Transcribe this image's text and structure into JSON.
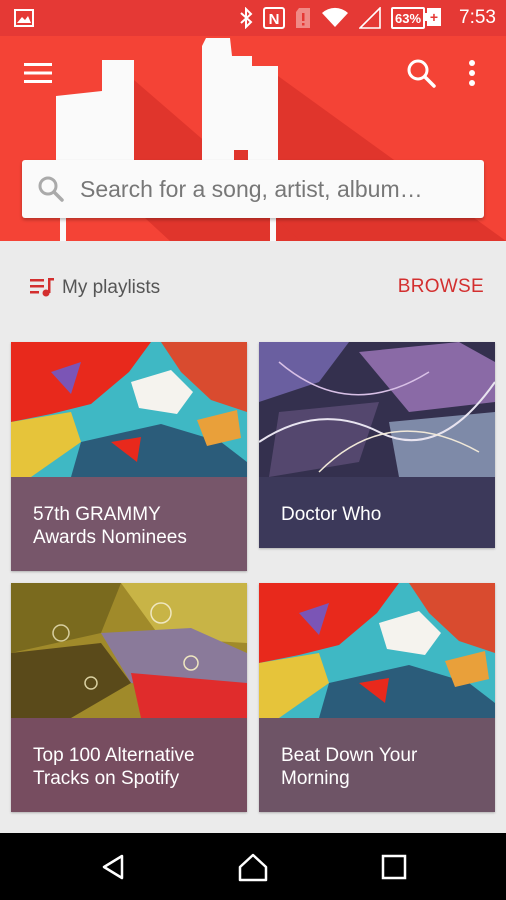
{
  "status_bar": {
    "battery": "63%",
    "time": "7:53",
    "icons": [
      "image-icon",
      "bluetooth-icon",
      "nfc-icon",
      "sim-alert-icon",
      "wifi-icon",
      "cell-signal-icon",
      "battery-icon"
    ]
  },
  "toolbar": {
    "menu_icon": "menu-icon",
    "search_icon": "search-icon",
    "more_icon": "more-vert-icon"
  },
  "search": {
    "placeholder": "Search for a song, artist, album…"
  },
  "section": {
    "icon": "playlist-icon",
    "label": "My playlists",
    "action": "BROWSE"
  },
  "playlists": [
    {
      "title": "57th GRAMMY Awards Nominees",
      "caption_color": "#77566a"
    },
    {
      "title": "Doctor Who",
      "caption_color": "#3c395a"
    },
    {
      "title": "Top 100 Alternative Tracks on Spotify",
      "caption_color": "#774d60"
    },
    {
      "title": "Beat Down Your Morning",
      "caption_color": "#6e5466"
    }
  ],
  "colors": {
    "primary": "#f44336",
    "status": "#e53935",
    "accent": "#d32f2f"
  },
  "nav": {
    "back": "back-icon",
    "home": "home-icon",
    "recents": "recents-icon"
  }
}
